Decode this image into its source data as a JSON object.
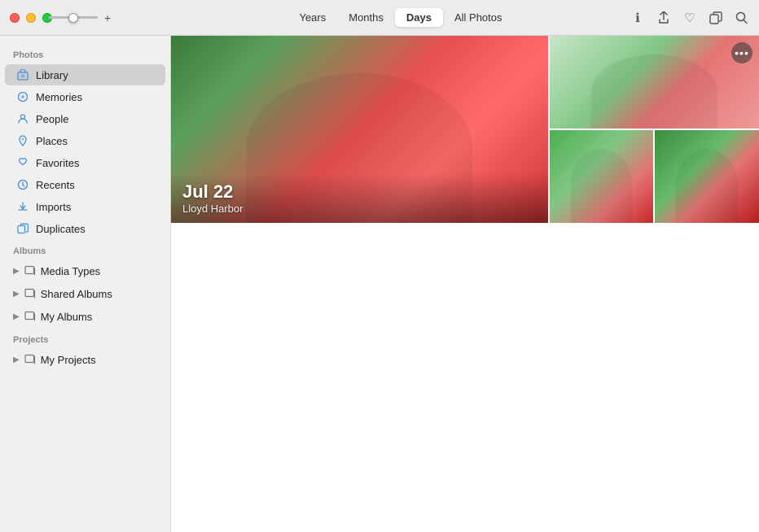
{
  "window": {
    "title": "Photos"
  },
  "titlebar": {
    "dots": [
      "red",
      "yellow",
      "green"
    ],
    "zoom_plus": "+"
  },
  "toolbar": {
    "tabs": [
      {
        "id": "years",
        "label": "Years"
      },
      {
        "id": "months",
        "label": "Months"
      },
      {
        "id": "days",
        "label": "Days"
      },
      {
        "id": "all-photos",
        "label": "All Photos"
      }
    ],
    "active_tab": "days",
    "icons": [
      {
        "id": "info",
        "symbol": "ℹ"
      },
      {
        "id": "share",
        "symbol": "⬆"
      },
      {
        "id": "heart",
        "symbol": "♡"
      },
      {
        "id": "duplicate",
        "symbol": "⧉"
      },
      {
        "id": "search",
        "symbol": "🔍"
      }
    ]
  },
  "sidebar": {
    "sections": [
      {
        "label": "Photos",
        "items": [
          {
            "id": "library",
            "label": "Library",
            "icon": "🖼",
            "active": true
          },
          {
            "id": "memories",
            "label": "Memories",
            "icon": "⊙"
          },
          {
            "id": "people",
            "label": "People",
            "icon": "⊙"
          },
          {
            "id": "places",
            "label": "Places",
            "icon": "⬆"
          },
          {
            "id": "favorites",
            "label": "Favorites",
            "icon": "♡"
          },
          {
            "id": "recents",
            "label": "Recents",
            "icon": "⊙"
          },
          {
            "id": "imports",
            "label": "Imports",
            "icon": "⬆"
          },
          {
            "id": "duplicates",
            "label": "Duplicates",
            "icon": "⧉"
          }
        ]
      },
      {
        "label": "Albums",
        "items": [
          {
            "id": "media-types",
            "label": "Media Types",
            "icon": "⧉",
            "group": true
          },
          {
            "id": "shared-albums",
            "label": "Shared Albums",
            "icon": "⧉",
            "group": true
          },
          {
            "id": "my-albums",
            "label": "My Albums",
            "icon": "⧉",
            "group": true
          }
        ]
      },
      {
        "label": "Projects",
        "items": [
          {
            "id": "my-projects",
            "label": "My Projects",
            "icon": "⧉",
            "group": true
          }
        ]
      }
    ]
  },
  "photo_section": {
    "date": "Jul 22",
    "location": "Lloyd Harbor",
    "more_label": "•••"
  }
}
